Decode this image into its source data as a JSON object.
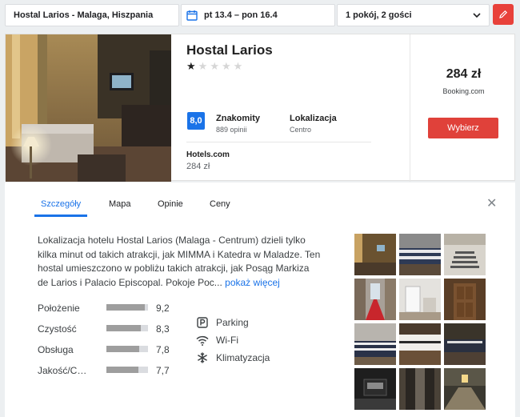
{
  "search": {
    "destination": "Hostal Larios - Malaga, Hiszpania",
    "dates": "pt 13.4 – pon 16.4",
    "guests": "1 pokój, 2 gości"
  },
  "hotel": {
    "name": "Hostal Larios",
    "stars": 1,
    "max_stars": 5,
    "rating_score": "8,0",
    "rating_word": "Znakomity",
    "rating_count": "889 opinii",
    "location_word": "Lokalizacja",
    "location_sub": "Centro",
    "provider_name": "Hotels.com",
    "provider_price": "284 zł",
    "main_price": "284 zł",
    "main_provider": "Booking.com",
    "select_label": "Wybierz"
  },
  "tabs": [
    "Szczegóły",
    "Mapa",
    "Opinie",
    "Ceny"
  ],
  "description": {
    "text": "Lokalizacja hotelu Hostal Larios (Malaga - Centrum) dzieli tylko kilka minut od takich atrakcji, jak MIMMA i Katedra w Maladze. Ten hostal umieszczono w pobliżu takich atrakcji, jak Posąg Markiza de Larios i Palacio Episcopal. Pokoje Poc... ",
    "more": "pokaż więcej"
  },
  "scores": [
    {
      "label": "Położenie",
      "value": "9,2",
      "fraction": 0.92
    },
    {
      "label": "Czystość",
      "value": "8,3",
      "fraction": 0.83
    },
    {
      "label": "Obsługa",
      "value": "7,8",
      "fraction": 0.78
    },
    {
      "label": "Jakość/C…",
      "value": "7,7",
      "fraction": 0.77
    }
  ],
  "amenities": [
    {
      "label": "Parking",
      "icon": "parking-icon"
    },
    {
      "label": "Wi-Fi",
      "icon": "wifi-icon"
    },
    {
      "label": "Klimatyzacja",
      "icon": "snowflake-icon"
    }
  ],
  "colors": {
    "accent_red": "#e0413a",
    "accent_blue": "#1a73e8"
  }
}
